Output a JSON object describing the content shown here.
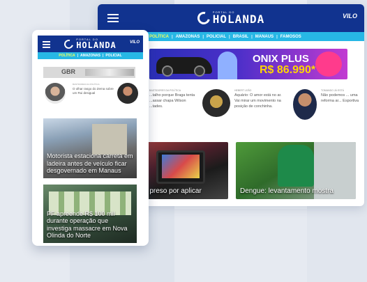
{
  "brand": {
    "logo_small": "PORTAL DO",
    "logo_name": "HOLANDA",
    "badge": "VILO"
  },
  "desktop": {
    "nav": [
      "POLÍTICA",
      "AMAZONAS",
      "POLICIAL",
      "BRASIL",
      "MANAUS",
      "FAMOSOS"
    ],
    "ad": {
      "title": "ONIX PLUS",
      "price": "R$ 86.990*"
    },
    "columns": [
      {
        "label": "BASTIDORES DA POLÍTICA",
        "text": "...talho porque Braga tenta ...assar chapa Wilson ...tades."
      },
      {
        "label": "HEBERT LEÃO",
        "text": "Aquário: O amor está no ar. Vai mirar um movimento na posição de conchinha."
      },
      {
        "label": "TOMANDO JÁ ESTÁ",
        "text": "Não podemos ... uma reforma ar... Esportiva"
      }
    ],
    "cards": [
      {
        "caption": "é preso por aplicar"
      },
      {
        "caption": "Dengue: levantamento mostra"
      }
    ]
  },
  "mobile": {
    "nav": [
      "POLÍTICA",
      "AMAZONAS",
      "POLICIAL"
    ],
    "ad_text": "GBR",
    "person": {
      "label": "BASTIDORES DA POLÍTICA",
      "text": "O olhar rasgo do Zema sobre um Rui desigual"
    },
    "stories": [
      {
        "caption": "Motorista estaciona carreta em ladeira antes de veículo ficar desgovernado em Manaus"
      },
      {
        "caption": "PF apreende R$ 100 mil durante operação que investiga massacre em Nova Olinda do Norte"
      }
    ]
  },
  "colors": {
    "header_blue": "#11338f",
    "nav_cyan": "#27b7e5",
    "nav_active": "#f6ff5a",
    "ad_price": "#ffd500"
  }
}
